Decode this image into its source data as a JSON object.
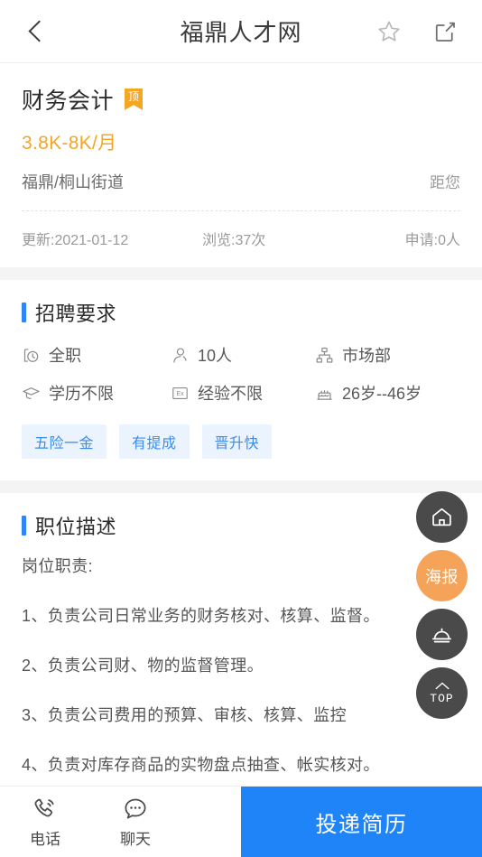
{
  "header": {
    "title": "福鼎人才网",
    "back_icon": "chevron-left-icon",
    "favorite_icon": "star-outline-icon",
    "share_icon": "share-box-icon"
  },
  "job": {
    "title": "财务会计",
    "badge": "顶",
    "salary": "3.8K-8K/月",
    "location": "福鼎/桐山街道",
    "distance_label": "距您"
  },
  "stats": [
    {
      "label": "更新:2021-01-12"
    },
    {
      "label": "浏览:37次"
    },
    {
      "label": "申请:0人"
    }
  ],
  "requirements": {
    "section_title": "招聘要求",
    "items": [
      {
        "icon": "clock-box-icon",
        "label": "全职"
      },
      {
        "icon": "person-icon",
        "label": "10人"
      },
      {
        "icon": "org-chart-icon",
        "label": "市场部"
      },
      {
        "icon": "graduation-cap-icon",
        "label": "学历不限"
      },
      {
        "icon": "experience-box-icon",
        "label": "经验不限"
      },
      {
        "icon": "birthday-cake-icon",
        "label": "26岁--46岁"
      }
    ],
    "tags": [
      "五险一金",
      "有提成",
      "晋升快"
    ]
  },
  "description": {
    "section_title": "职位描述",
    "lines": [
      "岗位职责:",
      "1、负责公司日常业务的财务核对、核算、监督。",
      "2、负责公司财、物的监督管理。",
      "3、负责公司费用的预算、审核、核算、监控",
      "4、负责对库存商品的实物盘点抽查、帐实核对。"
    ]
  },
  "floating_buttons": [
    {
      "icon": "home-icon",
      "label": ""
    },
    {
      "icon": "poster-icon",
      "label": "海报"
    },
    {
      "icon": "alarm-icon",
      "label": ""
    },
    {
      "icon": "scroll-top-icon",
      "label": "TOP"
    }
  ],
  "bottom_bar": {
    "phone": {
      "icon": "phone-call-icon",
      "label": "电话"
    },
    "chat": {
      "icon": "chat-bubble-icon",
      "label": "聊天"
    },
    "apply_label": "投递简历"
  },
  "colors": {
    "accent_blue": "#2E86F7",
    "button_blue": "#1E84F7",
    "salary_orange": "#F5A623",
    "poster_orange": "#F5A358",
    "tag_bg": "#EAF3FE",
    "fab_dark": "#4A4A4A"
  }
}
